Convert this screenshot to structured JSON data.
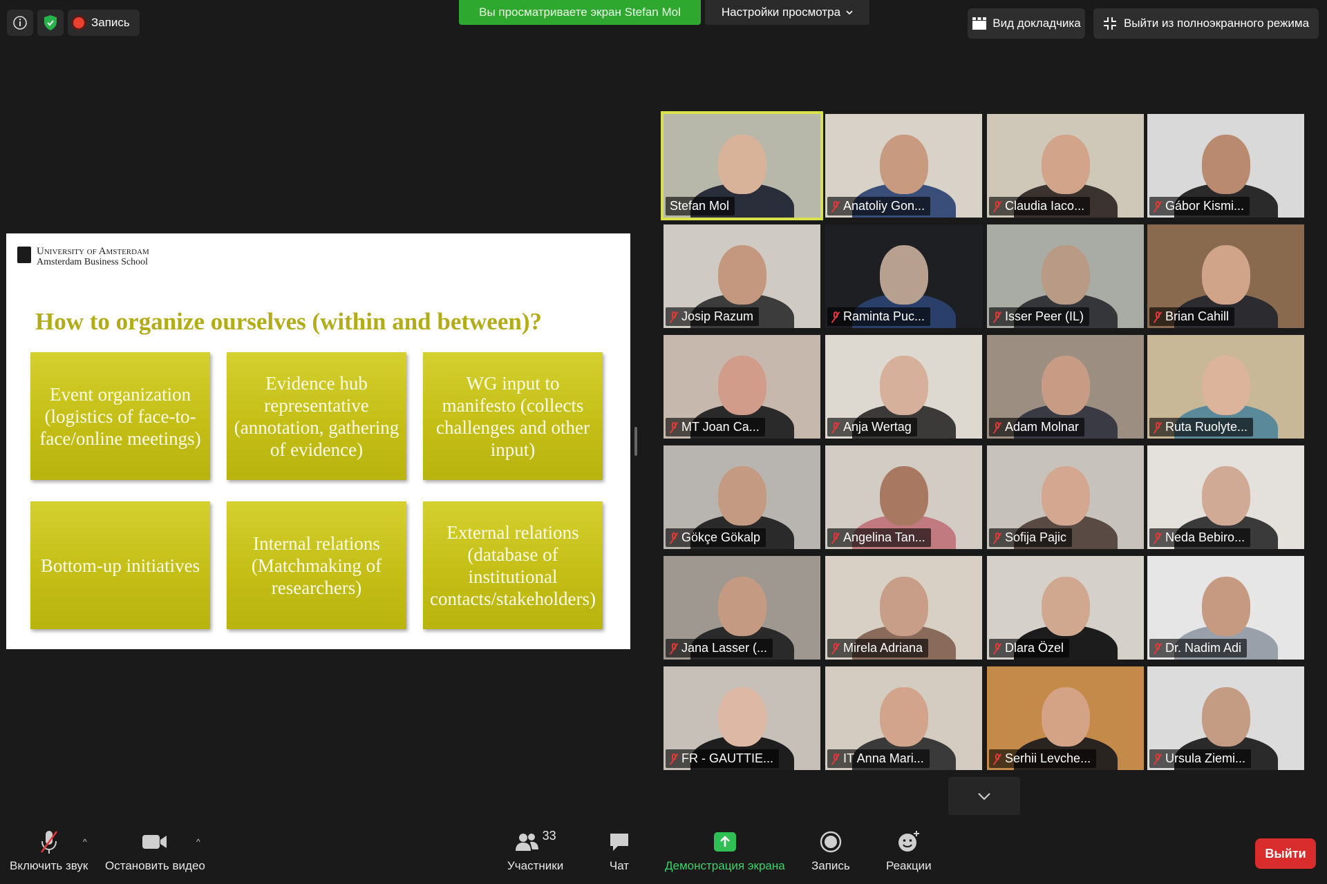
{
  "topbar": {
    "recording_label": "Запись",
    "share_banner": "Вы просматриваете экран Stefan Mol",
    "view_settings": "Настройки просмотра",
    "speaker_view": "Вид докладчика",
    "exit_fullscreen": "Выйти из полноэкранного режима"
  },
  "slide": {
    "logo_line1": "University of Amsterdam",
    "logo_line2": "Amsterdam Business School",
    "title": "How to organize ourselves (within and between)?",
    "boxes": [
      "Event organization (logistics of face-to-face/online meetings)",
      "Evidence hub representative (annotation, gathering of evidence)",
      "WG input to manifesto (collects challenges and other input)",
      "Bottom-up initiatives",
      "Internal relations (Matchmaking of researchers)",
      "External relations (database of institutional contacts/stakeholders)"
    ]
  },
  "participants": [
    {
      "name": "Stefan Mol",
      "muted": false,
      "active": true,
      "bg": "#b8b8aa",
      "skin": "#d8b39a",
      "shirt": "#2a2e3a"
    },
    {
      "name": "Anatoliy Gon...",
      "muted": true,
      "bg": "#d8d2c8",
      "skin": "#c89a80",
      "shirt": "#3a4e7a"
    },
    {
      "name": "Claudia Iaco...",
      "muted": true,
      "bg": "#cfc7b8",
      "skin": "#d2a48a",
      "shirt": "#3a3330"
    },
    {
      "name": "Gábor Kismi...",
      "muted": true,
      "bg": "#d9d9d9",
      "skin": "#b98a70",
      "shirt": "#2a2a2a"
    },
    {
      "name": "Josip Razum",
      "muted": true,
      "bg": "#cfcac4",
      "skin": "#c4987e",
      "shirt": "#3c3c3c"
    },
    {
      "name": "Raminta Puc...",
      "muted": true,
      "bg": "#1d1f22",
      "skin": "#b8a090",
      "shirt": "#2a3f6a"
    },
    {
      "name": "Isser Peer (IL)",
      "muted": true,
      "bg": "#a8aca4",
      "skin": "#b99a84",
      "shirt": "#34363a"
    },
    {
      "name": "Brian Cahill",
      "muted": true,
      "bg": "#8a6a4e",
      "skin": "#d0a488",
      "shirt": "#2c2c30"
    },
    {
      "name": "MT Joan Ca...",
      "muted": true,
      "bg": "#c7b8ae",
      "skin": "#d29c8a",
      "shirt": "#2a2a2a"
    },
    {
      "name": "Anja Wertag",
      "muted": true,
      "bg": "#ddd8d0",
      "skin": "#d6b09a",
      "shirt": "#3c3a38"
    },
    {
      "name": "Adam Molnar",
      "muted": true,
      "bg": "#9c8e80",
      "skin": "#c89c84",
      "shirt": "#3a3a44"
    },
    {
      "name": "Ruta Ruolyte...",
      "muted": true,
      "bg": "#c8b898",
      "skin": "#dcb49c",
      "shirt": "#5a8a9a"
    },
    {
      "name": "Gökçe Gökalp",
      "muted": true,
      "bg": "#b8b4b0",
      "skin": "#c49a82",
      "shirt": "#2a2a2a"
    },
    {
      "name": "Angelina Tan...",
      "muted": true,
      "bg": "#d2ccc4",
      "skin": "#a87860",
      "shirt": "#c07a80"
    },
    {
      "name": "Sofija Pajic",
      "muted": true,
      "bg": "#c8c2bc",
      "skin": "#d4a890",
      "shirt": "#5a4a44"
    },
    {
      "name": "Neda Bebiro...",
      "muted": true,
      "bg": "#e4e0dc",
      "skin": "#d0aa94",
      "shirt": "#3a3a3a"
    },
    {
      "name": "Jana Lasser (...",
      "muted": true,
      "bg": "#9e9890",
      "skin": "#c49a82",
      "shirt": "#2a2a2a"
    },
    {
      "name": "Mirela Adriana",
      "muted": true,
      "bg": "#d8d0c4",
      "skin": "#c89e88",
      "shirt": "#8a6a5a"
    },
    {
      "name": "Dlara Özel",
      "muted": true,
      "bg": "#d6d0ca",
      "skin": "#d0a890",
      "shirt": "#1c1c1c"
    },
    {
      "name": "Dr. Nadim Adi",
      "muted": true,
      "bg": "#e6e6e6",
      "skin": "#c69a80",
      "shirt": "#9aa0aa"
    },
    {
      "name": "FR - GAUTTIE...",
      "muted": true,
      "bg": "#c6c0b8",
      "skin": "#ddb8a4",
      "shirt": "#1e1e1e"
    },
    {
      "name": "IT Anna Mari...",
      "muted": true,
      "bg": "#d4ccc0",
      "skin": "#d2a48c",
      "shirt": "#3a3a3a"
    },
    {
      "name": "Serhii Levche...",
      "muted": true,
      "bg": "#c48a4a",
      "skin": "#d4a284",
      "shirt": "#2a2420"
    },
    {
      "name": "Ursula Ziemi...",
      "muted": true,
      "bg": "#dcdcdc",
      "skin": "#c49c84",
      "shirt": "#2a2a2a"
    }
  ],
  "toolbar": {
    "unmute": "Включить звук",
    "stop_video": "Остановить видео",
    "participants": "Участники",
    "participants_count": "33",
    "chat": "Чат",
    "share": "Демонстрация экрана",
    "record": "Запись",
    "reactions": "Реакции",
    "leave": "Выйти"
  },
  "colors": {
    "accent_green": "#2ea82e",
    "active_speaker": "#d8e24a",
    "slide_gold": "#c4be17",
    "leave_red": "#d92d2d"
  }
}
